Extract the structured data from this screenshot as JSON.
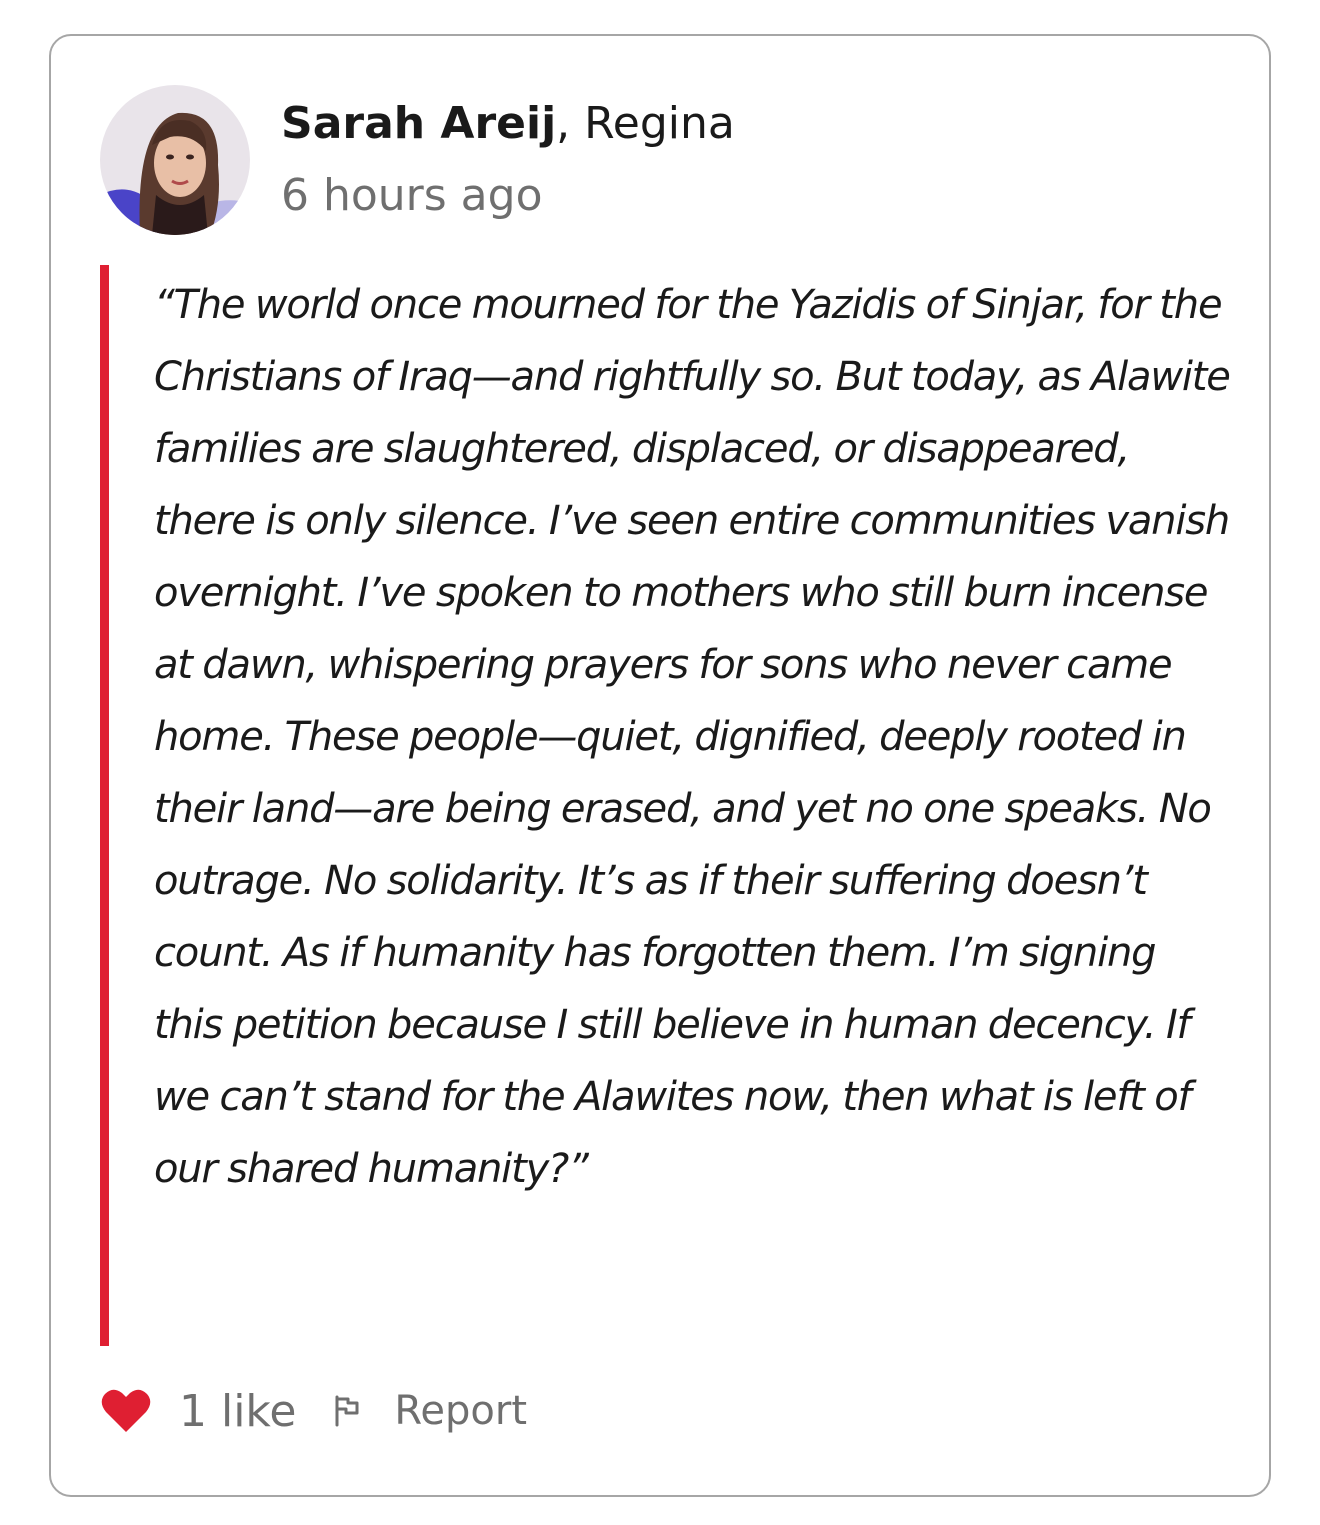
{
  "comment": {
    "author": {
      "name": "Sarah Areij",
      "location_separator": ", ",
      "location": "Regina",
      "avatar_icon": "user-avatar-photo"
    },
    "timestamp": "6 hours ago",
    "quote_text": "“The world once mourned for the Yazidis of Sinjar, for the Christians of Iraq—and rightfully so. But today, as Alawite families are slaughtered, displaced, or disappeared, there is only silence. I’ve seen entire communities vanish overnight. I’ve spoken to mothers who still burn incense at dawn, whispering prayers for sons who never came home. These people—quiet, dignified, deeply rooted in their land—are being erased, and yet no one speaks. No outrage. No solidarity. It’s as if their suffering doesn’t count. As if humanity has forgotten them. I’m signing this petition because I still believe in human decency. If we can’t stand for the Alawites now, then what is left of our shared humanity?”",
    "likes_label": "1 like",
    "report_label": "Report",
    "icons": {
      "like": "heart-icon",
      "report": "flag-icon"
    },
    "colors": {
      "accent": "#df1f32",
      "muted_text": "#6f6f6f",
      "border": "#a6a6a6"
    }
  }
}
